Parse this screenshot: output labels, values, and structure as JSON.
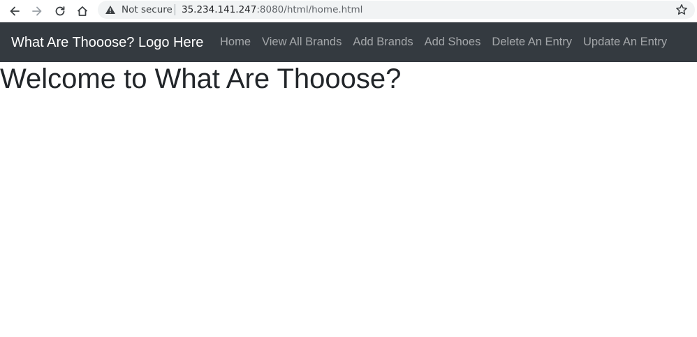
{
  "browser": {
    "security_label": "Not secure",
    "url_host": "35.234.141.247",
    "url_rest": ":8080/html/home.html",
    "icons": [
      "back-icon",
      "forward-icon",
      "reload-icon",
      "home-icon",
      "warning-icon",
      "star-icon"
    ]
  },
  "navbar": {
    "brand": "What Are Thooose? Logo Here",
    "links": [
      {
        "label": "Home"
      },
      {
        "label": "View All Brands"
      },
      {
        "label": "Add Brands"
      },
      {
        "label": "Add Shoes"
      },
      {
        "label": "Delete An Entry"
      },
      {
        "label": "Update An Entry"
      }
    ],
    "background": "#343a40"
  },
  "main": {
    "heading": "Welcome to What Are Thooose?"
  }
}
